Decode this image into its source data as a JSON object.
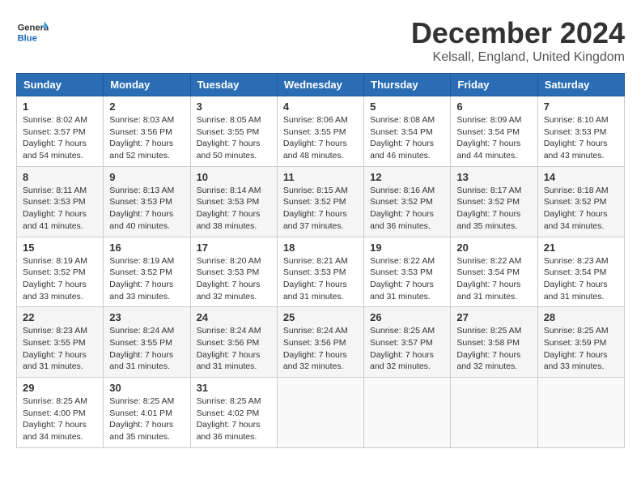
{
  "header": {
    "logo_line1": "General",
    "logo_line2": "Blue",
    "title": "December 2024",
    "subtitle": "Kelsall, England, United Kingdom"
  },
  "weekdays": [
    "Sunday",
    "Monday",
    "Tuesday",
    "Wednesday",
    "Thursday",
    "Friday",
    "Saturday"
  ],
  "weeks": [
    [
      {
        "day": "1",
        "sunrise": "Sunrise: 8:02 AM",
        "sunset": "Sunset: 3:57 PM",
        "daylight": "Daylight: 7 hours and 54 minutes."
      },
      {
        "day": "2",
        "sunrise": "Sunrise: 8:03 AM",
        "sunset": "Sunset: 3:56 PM",
        "daylight": "Daylight: 7 hours and 52 minutes."
      },
      {
        "day": "3",
        "sunrise": "Sunrise: 8:05 AM",
        "sunset": "Sunset: 3:55 PM",
        "daylight": "Daylight: 7 hours and 50 minutes."
      },
      {
        "day": "4",
        "sunrise": "Sunrise: 8:06 AM",
        "sunset": "Sunset: 3:55 PM",
        "daylight": "Daylight: 7 hours and 48 minutes."
      },
      {
        "day": "5",
        "sunrise": "Sunrise: 8:08 AM",
        "sunset": "Sunset: 3:54 PM",
        "daylight": "Daylight: 7 hours and 46 minutes."
      },
      {
        "day": "6",
        "sunrise": "Sunrise: 8:09 AM",
        "sunset": "Sunset: 3:54 PM",
        "daylight": "Daylight: 7 hours and 44 minutes."
      },
      {
        "day": "7",
        "sunrise": "Sunrise: 8:10 AM",
        "sunset": "Sunset: 3:53 PM",
        "daylight": "Daylight: 7 hours and 43 minutes."
      }
    ],
    [
      {
        "day": "8",
        "sunrise": "Sunrise: 8:11 AM",
        "sunset": "Sunset: 3:53 PM",
        "daylight": "Daylight: 7 hours and 41 minutes."
      },
      {
        "day": "9",
        "sunrise": "Sunrise: 8:13 AM",
        "sunset": "Sunset: 3:53 PM",
        "daylight": "Daylight: 7 hours and 40 minutes."
      },
      {
        "day": "10",
        "sunrise": "Sunrise: 8:14 AM",
        "sunset": "Sunset: 3:53 PM",
        "daylight": "Daylight: 7 hours and 38 minutes."
      },
      {
        "day": "11",
        "sunrise": "Sunrise: 8:15 AM",
        "sunset": "Sunset: 3:52 PM",
        "daylight": "Daylight: 7 hours and 37 minutes."
      },
      {
        "day": "12",
        "sunrise": "Sunrise: 8:16 AM",
        "sunset": "Sunset: 3:52 PM",
        "daylight": "Daylight: 7 hours and 36 minutes."
      },
      {
        "day": "13",
        "sunrise": "Sunrise: 8:17 AM",
        "sunset": "Sunset: 3:52 PM",
        "daylight": "Daylight: 7 hours and 35 minutes."
      },
      {
        "day": "14",
        "sunrise": "Sunrise: 8:18 AM",
        "sunset": "Sunset: 3:52 PM",
        "daylight": "Daylight: 7 hours and 34 minutes."
      }
    ],
    [
      {
        "day": "15",
        "sunrise": "Sunrise: 8:19 AM",
        "sunset": "Sunset: 3:52 PM",
        "daylight": "Daylight: 7 hours and 33 minutes."
      },
      {
        "day": "16",
        "sunrise": "Sunrise: 8:19 AM",
        "sunset": "Sunset: 3:52 PM",
        "daylight": "Daylight: 7 hours and 33 minutes."
      },
      {
        "day": "17",
        "sunrise": "Sunrise: 8:20 AM",
        "sunset": "Sunset: 3:53 PM",
        "daylight": "Daylight: 7 hours and 32 minutes."
      },
      {
        "day": "18",
        "sunrise": "Sunrise: 8:21 AM",
        "sunset": "Sunset: 3:53 PM",
        "daylight": "Daylight: 7 hours and 31 minutes."
      },
      {
        "day": "19",
        "sunrise": "Sunrise: 8:22 AM",
        "sunset": "Sunset: 3:53 PM",
        "daylight": "Daylight: 7 hours and 31 minutes."
      },
      {
        "day": "20",
        "sunrise": "Sunrise: 8:22 AM",
        "sunset": "Sunset: 3:54 PM",
        "daylight": "Daylight: 7 hours and 31 minutes."
      },
      {
        "day": "21",
        "sunrise": "Sunrise: 8:23 AM",
        "sunset": "Sunset: 3:54 PM",
        "daylight": "Daylight: 7 hours and 31 minutes."
      }
    ],
    [
      {
        "day": "22",
        "sunrise": "Sunrise: 8:23 AM",
        "sunset": "Sunset: 3:55 PM",
        "daylight": "Daylight: 7 hours and 31 minutes."
      },
      {
        "day": "23",
        "sunrise": "Sunrise: 8:24 AM",
        "sunset": "Sunset: 3:55 PM",
        "daylight": "Daylight: 7 hours and 31 minutes."
      },
      {
        "day": "24",
        "sunrise": "Sunrise: 8:24 AM",
        "sunset": "Sunset: 3:56 PM",
        "daylight": "Daylight: 7 hours and 31 minutes."
      },
      {
        "day": "25",
        "sunrise": "Sunrise: 8:24 AM",
        "sunset": "Sunset: 3:56 PM",
        "daylight": "Daylight: 7 hours and 32 minutes."
      },
      {
        "day": "26",
        "sunrise": "Sunrise: 8:25 AM",
        "sunset": "Sunset: 3:57 PM",
        "daylight": "Daylight: 7 hours and 32 minutes."
      },
      {
        "day": "27",
        "sunrise": "Sunrise: 8:25 AM",
        "sunset": "Sunset: 3:58 PM",
        "daylight": "Daylight: 7 hours and 32 minutes."
      },
      {
        "day": "28",
        "sunrise": "Sunrise: 8:25 AM",
        "sunset": "Sunset: 3:59 PM",
        "daylight": "Daylight: 7 hours and 33 minutes."
      }
    ],
    [
      {
        "day": "29",
        "sunrise": "Sunrise: 8:25 AM",
        "sunset": "Sunset: 4:00 PM",
        "daylight": "Daylight: 7 hours and 34 minutes."
      },
      {
        "day": "30",
        "sunrise": "Sunrise: 8:25 AM",
        "sunset": "Sunset: 4:01 PM",
        "daylight": "Daylight: 7 hours and 35 minutes."
      },
      {
        "day": "31",
        "sunrise": "Sunrise: 8:25 AM",
        "sunset": "Sunset: 4:02 PM",
        "daylight": "Daylight: 7 hours and 36 minutes."
      },
      null,
      null,
      null,
      null
    ]
  ]
}
